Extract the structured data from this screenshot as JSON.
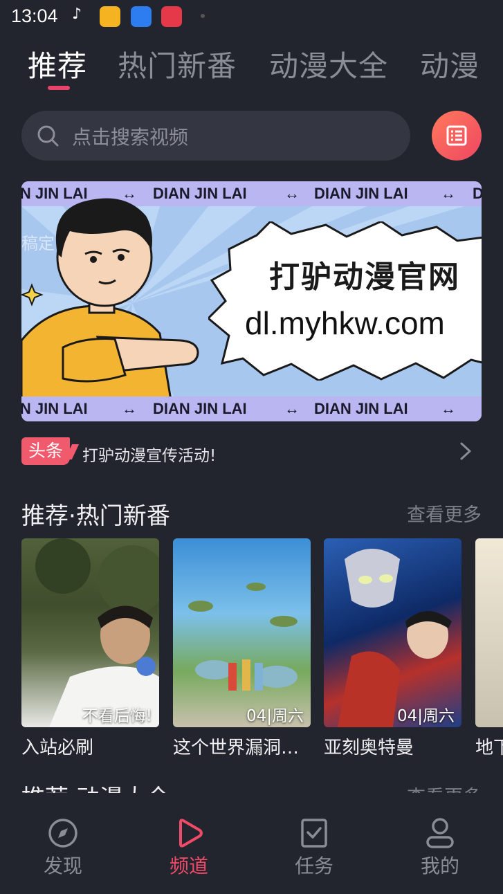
{
  "status_bar": {
    "time": "13:04"
  },
  "top_tabs": [
    {
      "label": "推荐",
      "active": true
    },
    {
      "label": "热门新番",
      "active": false
    },
    {
      "label": "动漫大全",
      "active": false
    },
    {
      "label": "动漫",
      "active": false
    }
  ],
  "search": {
    "placeholder": "点击搜索视频"
  },
  "banner": {
    "strip_text": "DIAN JIN LAI",
    "title": "打驴动漫官网",
    "url": "dl.myhkw.com",
    "watermark": "稿定"
  },
  "headline": {
    "badge": "头条",
    "text": "打驴动漫宣传活动!"
  },
  "section_hot": {
    "title": "推荐·热门新番",
    "more": "查看更多",
    "items": [
      {
        "title": "入站必刷",
        "badge": "不看后悔!"
      },
      {
        "title": "这个世界漏洞…",
        "badge": "04|周六"
      },
      {
        "title": "亚刻奥特曼",
        "badge": "04|周六"
      },
      {
        "title": "地下",
        "badge": ""
      }
    ]
  },
  "section_all": {
    "title": "推荐·动漫大全",
    "more": "查看更多"
  },
  "bottom_nav": [
    {
      "label": "发现",
      "icon": "compass-icon",
      "active": false
    },
    {
      "label": "频道",
      "icon": "play-icon",
      "active": true
    },
    {
      "label": "任务",
      "icon": "task-icon",
      "active": false
    },
    {
      "label": "我的",
      "icon": "user-icon",
      "active": false
    }
  ],
  "colors": {
    "background": "#22242e",
    "accent": "#ef4a68",
    "banner_bg": "#a9c9ef"
  }
}
